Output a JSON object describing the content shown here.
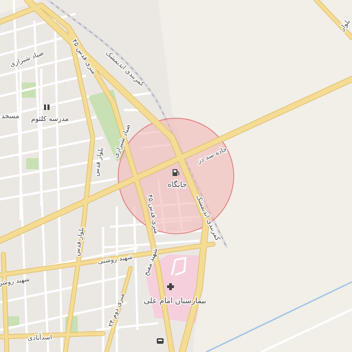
{
  "map": {
    "colors": {
      "background": "#f2efe9",
      "urban": "#ebe8e3",
      "park": "#c8e0b4",
      "hospital_area": "#f5d0dc",
      "major_road": "#f5dc95",
      "major_road_casing": "#e0bf6a",
      "minor_road": "#ffffff",
      "railway": "#b8b8c4",
      "water": "#9fc3e8",
      "highlight_circle_fill": "#f2b8b8",
      "highlight_circle_stroke": "#e07a7a"
    },
    "labels": {
      "school": "مدرسه کلثوم",
      "mosque": "مسجد",
      "fuel_station": "جایگاه",
      "hospital": "بیمارستان امام علی",
      "road_sad_dez": "جاده سد دز",
      "road_kamarbandi_1": "کمربندی اندیمشک",
      "road_kamarbandi_2": "کمربندی اندیمشک",
      "road_sayad_shirazi_1": "صیاد شیرازی",
      "road_sayad_shirazi_2": "صیاد شیرازی",
      "road_45_metri_1": "۴۵ متری قدس",
      "road_45_metri_2": "۴۵ متری قدس",
      "road_bolvar_quds_1": "بلوار قدس",
      "road_bolvar_quds_2": "بلوار قدس",
      "road_roshani_1": "شهید روشنی",
      "road_roshani_2": "شهید روشن",
      "road_asadabadi": "اسدآبادی",
      "road_24_metri": "۲۴ متری دوم",
      "road_shahid_mofatteh": "شهید مفتح",
      "road_top_right": "بلوار"
    }
  }
}
